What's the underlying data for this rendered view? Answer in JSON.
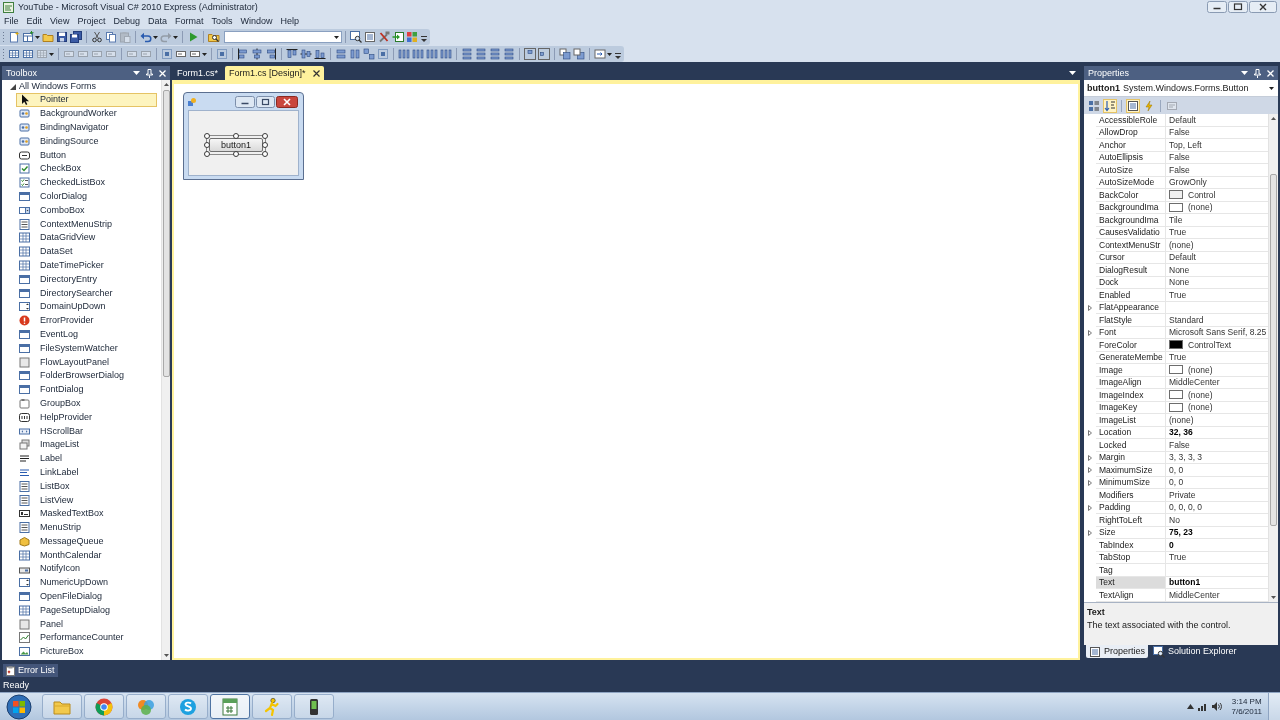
{
  "window": {
    "title": "YouTube - Microsoft Visual C# 2010 Express (Administrator)"
  },
  "menu": [
    "File",
    "Edit",
    "View",
    "Project",
    "Debug",
    "Data",
    "Format",
    "Tools",
    "Window",
    "Help"
  ],
  "toolbars": [
    {
      "buttons": [
        {
          "disabled": false
        },
        {
          "disabled": false
        },
        {
          "disabled": false
        },
        {
          "disabled": false
        },
        {
          "disabled": false
        },
        {
          "disabled": false
        },
        {
          "disabled": false
        },
        {
          "disabled": true
        },
        {
          "disabled": false
        },
        {
          "disabled": true
        },
        {
          "disabled": false
        },
        {
          "disabled": false
        },
        {
          "disabled": false
        },
        {
          "disabled": false
        },
        {
          "disabled": false
        },
        {
          "disabled": false
        },
        {
          "disabled": false
        }
      ]
    },
    {
      "buttons": [
        {
          "disabled": false
        },
        {
          "disabled": false
        },
        {
          "disabled": true
        },
        {
          "disabled": true
        },
        {
          "disabled": true
        },
        {
          "disabled": true
        },
        {
          "disabled": true
        },
        {
          "disabled": true
        },
        {
          "disabled": true
        },
        {
          "disabled": false
        },
        {
          "disabled": false
        },
        {
          "disabled": false
        },
        {
          "disabled": false
        },
        {
          "disabled": false
        },
        {
          "disabled": false
        },
        {
          "disabled": false
        },
        {
          "disabled": false
        },
        {
          "disabled": false
        },
        {
          "disabled": false
        },
        {
          "disabled": false
        },
        {
          "disabled": false
        },
        {
          "disabled": false
        },
        {
          "disabled": false
        },
        {
          "disabled": false
        },
        {
          "disabled": false
        },
        {
          "disabled": false
        },
        {
          "disabled": false
        },
        {
          "disabled": false
        },
        {
          "disabled": false
        },
        {
          "disabled": false
        },
        {
          "disabled": false
        },
        {
          "disabled": false
        },
        {
          "disabled": false
        },
        {
          "disabled": false
        },
        {
          "disabled": false
        },
        {
          "disabled": false
        }
      ]
    }
  ],
  "toolbox": {
    "title": "Toolbox",
    "groups": [
      {
        "label": "All Windows Forms",
        "expanded": true,
        "items": [
          {
            "label": "Pointer",
            "selected": true
          },
          {
            "label": "BackgroundWorker",
            "selected": false
          },
          {
            "label": "BindingNavigator",
            "selected": false
          },
          {
            "label": "BindingSource",
            "selected": false
          },
          {
            "label": "Button",
            "selected": false
          },
          {
            "label": "CheckBox",
            "selected": false
          },
          {
            "label": "CheckedListBox",
            "selected": false
          },
          {
            "label": "ColorDialog",
            "selected": false
          },
          {
            "label": "ComboBox",
            "selected": false
          },
          {
            "label": "ContextMenuStrip",
            "selected": false
          },
          {
            "label": "DataGridView",
            "selected": false
          },
          {
            "label": "DataSet",
            "selected": false
          },
          {
            "label": "DateTimePicker",
            "selected": false
          },
          {
            "label": "DirectoryEntry",
            "selected": false
          },
          {
            "label": "DirectorySearcher",
            "selected": false
          },
          {
            "label": "DomainUpDown",
            "selected": false
          },
          {
            "label": "ErrorProvider",
            "selected": false
          },
          {
            "label": "EventLog",
            "selected": false
          },
          {
            "label": "FileSystemWatcher",
            "selected": false
          },
          {
            "label": "FlowLayoutPanel",
            "selected": false
          },
          {
            "label": "FolderBrowserDialog",
            "selected": false
          },
          {
            "label": "FontDialog",
            "selected": false
          },
          {
            "label": "GroupBox",
            "selected": false
          },
          {
            "label": "HelpProvider",
            "selected": false
          },
          {
            "label": "HScrollBar",
            "selected": false
          },
          {
            "label": "ImageList",
            "selected": false
          },
          {
            "label": "Label",
            "selected": false
          },
          {
            "label": "LinkLabel",
            "selected": false
          },
          {
            "label": "ListBox",
            "selected": false
          },
          {
            "label": "ListView",
            "selected": false
          },
          {
            "label": "MaskedTextBox",
            "selected": false
          },
          {
            "label": "MenuStrip",
            "selected": false
          },
          {
            "label": "MessageQueue",
            "selected": false
          },
          {
            "label": "MonthCalendar",
            "selected": false
          },
          {
            "label": "NotifyIcon",
            "selected": false
          },
          {
            "label": "NumericUpDown",
            "selected": false
          },
          {
            "label": "OpenFileDialog",
            "selected": false
          },
          {
            "label": "PageSetupDialog",
            "selected": false
          },
          {
            "label": "Panel",
            "selected": false
          },
          {
            "label": "PerformanceCounter",
            "selected": false
          },
          {
            "label": "PictureBox",
            "selected": false
          }
        ]
      }
    ]
  },
  "document_tabs": [
    {
      "label": "Form1.cs*",
      "selected": false
    },
    {
      "label": "Form1.cs [Design]*",
      "selected": true
    }
  ],
  "designer": {
    "form": {
      "button": {
        "text": "button1",
        "selected": true
      }
    }
  },
  "properties": {
    "title": "Properties",
    "object_name": "button1",
    "object_type": "System.Windows.Forms.Button",
    "toolbar": [
      {
        "selected": false,
        "disabled": false
      },
      {
        "selected": true,
        "disabled": false
      },
      {
        "selected": true,
        "disabled": false
      },
      {
        "selected": false,
        "disabled": false
      },
      {
        "selected": false,
        "disabled": true
      }
    ],
    "rows": [
      {
        "name": "AccessibleRole",
        "value": "Default",
        "kind": "text",
        "expandable": false,
        "modified": false,
        "selected": false
      },
      {
        "name": "AllowDrop",
        "value": "False",
        "kind": "text",
        "expandable": false,
        "modified": false,
        "selected": false
      },
      {
        "name": "Anchor",
        "value": "Top, Left",
        "kind": "text",
        "expandable": false,
        "modified": false,
        "selected": false
      },
      {
        "name": "AutoEllipsis",
        "value": "False",
        "kind": "text",
        "expandable": false,
        "modified": false,
        "selected": false
      },
      {
        "name": "AutoSize",
        "value": "False",
        "kind": "text",
        "expandable": false,
        "modified": false,
        "selected": false
      },
      {
        "name": "AutoSizeMode",
        "value": "GrowOnly",
        "kind": "text",
        "expandable": false,
        "modified": false,
        "selected": false
      },
      {
        "name": "BackColor",
        "value": "Control",
        "kind": "color",
        "color": "#f0f0f0",
        "expandable": false,
        "modified": false,
        "selected": false
      },
      {
        "name": "BackgroundIma",
        "value": "(none)",
        "kind": "image",
        "expandable": false,
        "modified": false,
        "selected": false
      },
      {
        "name": "BackgroundIma",
        "value": "Tile",
        "kind": "text",
        "expandable": false,
        "modified": false,
        "selected": false
      },
      {
        "name": "CausesValidatio",
        "value": "True",
        "kind": "text",
        "expandable": false,
        "modified": false,
        "selected": false
      },
      {
        "name": "ContextMenuStr",
        "value": "(none)",
        "kind": "text",
        "expandable": false,
        "modified": false,
        "selected": false
      },
      {
        "name": "Cursor",
        "value": "Default",
        "kind": "text",
        "expandable": false,
        "modified": false,
        "selected": false
      },
      {
        "name": "DialogResult",
        "value": "None",
        "kind": "text",
        "expandable": false,
        "modified": false,
        "selected": false
      },
      {
        "name": "Dock",
        "value": "None",
        "kind": "text",
        "expandable": false,
        "modified": false,
        "selected": false
      },
      {
        "name": "Enabled",
        "value": "True",
        "kind": "text",
        "expandable": false,
        "modified": false,
        "selected": false
      },
      {
        "name": "FlatAppearance",
        "kind": "text",
        "expandable": true,
        "selected": false
      },
      {
        "name": "FlatStyle",
        "value": "Standard",
        "kind": "text",
        "expandable": false,
        "modified": false,
        "selected": false
      },
      {
        "name": "Font",
        "value": "Microsoft Sans Serif, 8.25",
        "kind": "text",
        "expandable": true,
        "modified": false,
        "selected": false
      },
      {
        "name": "ForeColor",
        "value": "ControlText",
        "kind": "color",
        "color": "#000000",
        "expandable": false,
        "modified": false,
        "selected": false
      },
      {
        "name": "GenerateMembe",
        "value": "True",
        "kind": "text",
        "expandable": false,
        "modified": false,
        "selected": false
      },
      {
        "name": "Image",
        "value": "(none)",
        "kind": "image",
        "expandable": false,
        "modified": false,
        "selected": false
      },
      {
        "name": "ImageAlign",
        "value": "MiddleCenter",
        "kind": "text",
        "expandable": false,
        "modified": false,
        "selected": false
      },
      {
        "name": "ImageIndex",
        "value": "(none)",
        "kind": "image",
        "expandable": false,
        "modified": false,
        "selected": false
      },
      {
        "name": "ImageKey",
        "value": "(none)",
        "kind": "image",
        "expandable": false,
        "modified": false,
        "selected": false
      },
      {
        "name": "ImageList",
        "value": "(none)",
        "kind": "text",
        "expandable": false,
        "modified": false,
        "selected": false
      },
      {
        "name": "Location",
        "value": "32, 36",
        "kind": "text",
        "expandable": true,
        "modified": true,
        "selected": false
      },
      {
        "name": "Locked",
        "value": "False",
        "kind": "text",
        "expandable": false,
        "modified": false,
        "selected": false
      },
      {
        "name": "Margin",
        "value": "3, 3, 3, 3",
        "kind": "text",
        "expandable": true,
        "modified": false,
        "selected": false
      },
      {
        "name": "MaximumSize",
        "value": "0, 0",
        "kind": "text",
        "expandable": true,
        "modified": false,
        "selected": false
      },
      {
        "name": "MinimumSize",
        "value": "0, 0",
        "kind": "text",
        "expandable": true,
        "modified": false,
        "selected": false
      },
      {
        "name": "Modifiers",
        "value": "Private",
        "kind": "text",
        "expandable": false,
        "modified": false,
        "selected": false
      },
      {
        "name": "Padding",
        "value": "0, 0, 0, 0",
        "kind": "text",
        "expandable": true,
        "modified": false,
        "selected": false
      },
      {
        "name": "RightToLeft",
        "value": "No",
        "kind": "text",
        "expandable": false,
        "modified": false,
        "selected": false
      },
      {
        "name": "Size",
        "value": "75, 23",
        "kind": "text",
        "expandable": true,
        "modified": true,
        "selected": false
      },
      {
        "name": "TabIndex",
        "value": "0",
        "kind": "text",
        "expandable": false,
        "modified": true,
        "selected": false
      },
      {
        "name": "TabStop",
        "value": "True",
        "kind": "text",
        "expandable": false,
        "modified": false,
        "selected": false
      },
      {
        "name": "Tag",
        "kind": "text",
        "expandable": false,
        "selected": false
      },
      {
        "name": "Text",
        "value": "button1",
        "kind": "text",
        "expandable": false,
        "modified": true,
        "selected": true
      },
      {
        "name": "TextAlign",
        "value": "MiddleCenter",
        "kind": "text",
        "expandable": false,
        "modified": false,
        "selected": false
      }
    ],
    "description": {
      "title": "Text",
      "text": "The text associated with the control."
    },
    "tabs": [
      {
        "label": "Properties",
        "selected": true
      },
      {
        "label": "Solution Explorer",
        "selected": false
      }
    ]
  },
  "error_list": {
    "label": "Error List"
  },
  "status_bar": {
    "text": "Ready"
  },
  "taskbar": {
    "apps": [
      {
        "selected": false
      },
      {
        "selected": false
      },
      {
        "selected": false
      },
      {
        "selected": false
      },
      {
        "selected": true
      },
      {
        "selected": false
      },
      {
        "selected": false
      }
    ],
    "clock": {
      "time": "3:14 PM",
      "date": "7/6/2011"
    }
  }
}
